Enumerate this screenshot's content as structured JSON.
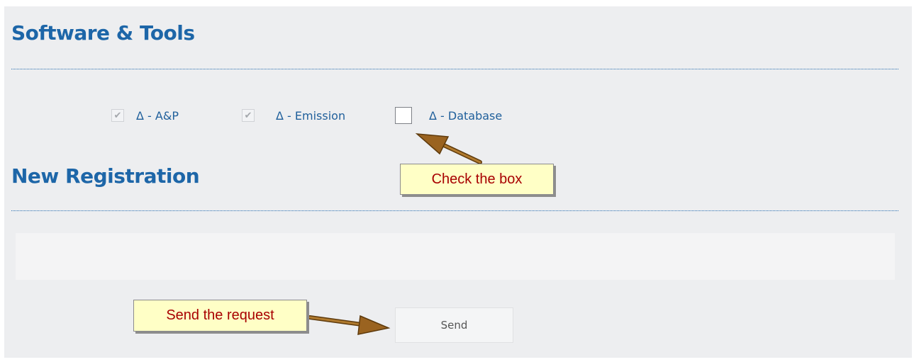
{
  "software_tools": {
    "title": "Software & Tools",
    "options": [
      {
        "label": "Δ - A&P",
        "checked": true,
        "disabled": true
      },
      {
        "label": "Δ - Emission",
        "checked": true,
        "disabled": true
      },
      {
        "label": "Δ - Database",
        "checked": false,
        "disabled": false
      }
    ],
    "check_glyph": "✔"
  },
  "new_registration": {
    "title": "New Registration",
    "send_label": "Send"
  },
  "annotations": {
    "check_the_box": "Check the box",
    "send_the_request": "Send the request",
    "callout_bg": "#ffffc6",
    "callout_text_color": "#a80000",
    "arrow_color": "#8b5a1c"
  },
  "colors": {
    "heading": "#1d66a8",
    "label": "#1f5f9b",
    "panel_bg": "#edeef0"
  }
}
